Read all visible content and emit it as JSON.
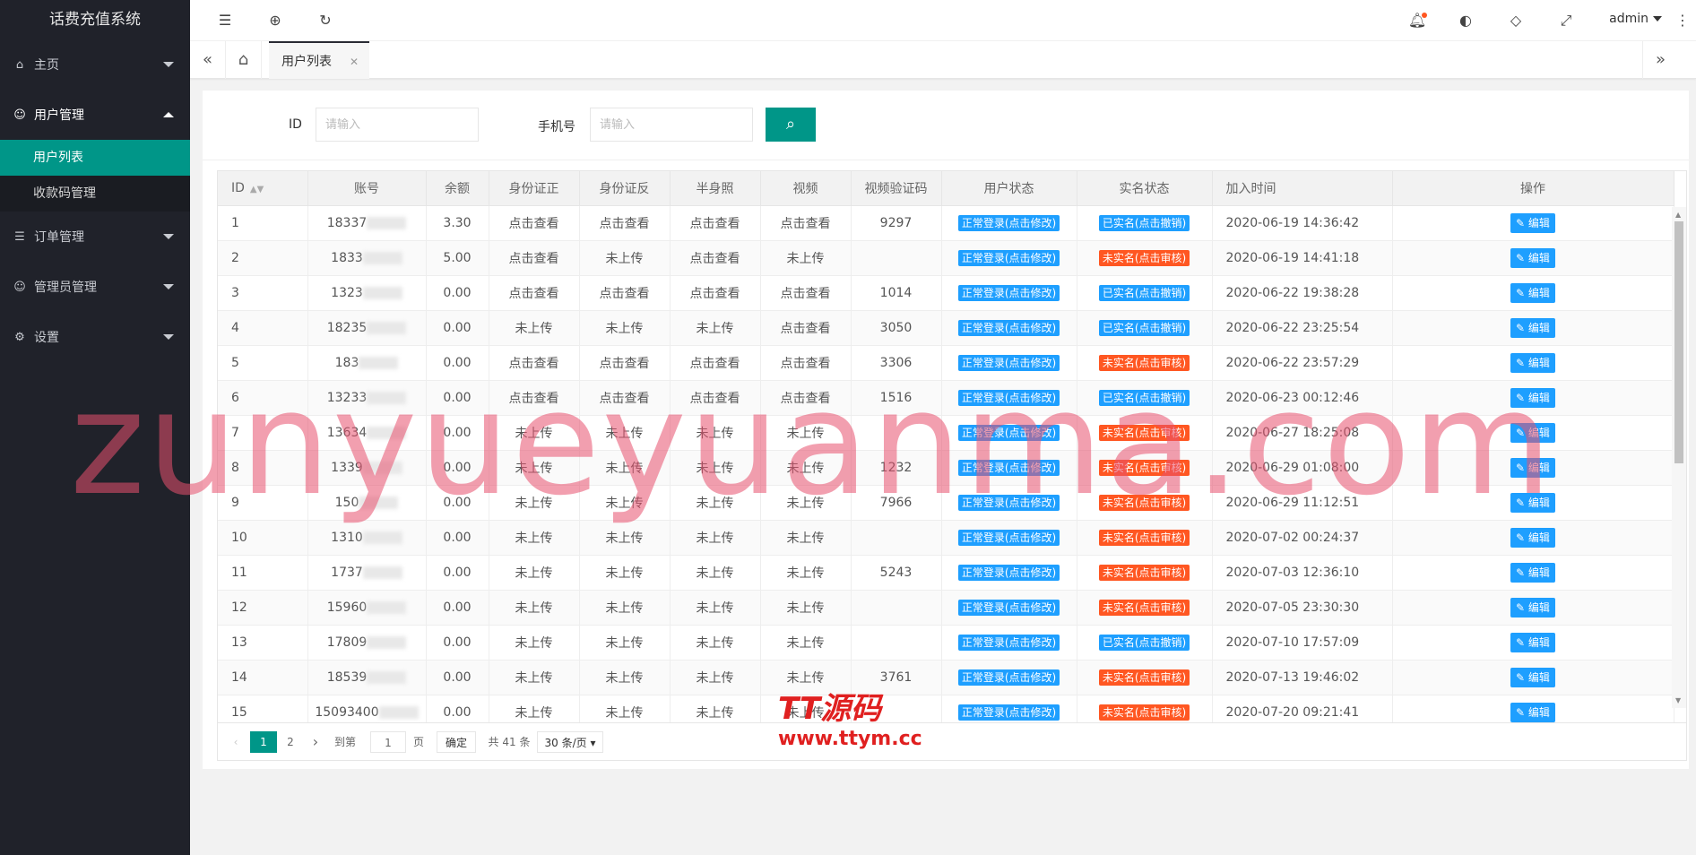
{
  "app": {
    "title": "话费充值系统"
  },
  "sidebar": {
    "items": [
      {
        "label": "主页",
        "icon": "home-icon",
        "open": false
      },
      {
        "label": "用户管理",
        "icon": "user-icon",
        "open": true,
        "children": [
          "用户列表",
          "收款码管理"
        ]
      },
      {
        "label": "订单管理",
        "icon": "list-icon",
        "open": false
      },
      {
        "label": "管理员管理",
        "icon": "user-icon",
        "open": false
      },
      {
        "label": "设置",
        "icon": "gear-icon",
        "open": false
      }
    ]
  },
  "header": {
    "user": "admin"
  },
  "tabs": {
    "active": "用户列表"
  },
  "search": {
    "id_label": "ID",
    "id_placeholder": "请输入",
    "phone_label": "手机号",
    "phone_placeholder": "请输入"
  },
  "table": {
    "columns": [
      "ID",
      "账号",
      "余额",
      "身份证正",
      "身份证反",
      "半身照",
      "视频",
      "视频验证码",
      "用户状态",
      "实名状态",
      "加入时间",
      "操作"
    ],
    "edit_label": "编辑",
    "rows": [
      [
        "1",
        "18337",
        "3.30",
        "点击查看",
        "点击查看",
        "点击查看",
        "点击查看",
        "9297",
        "正常登录(点击修改)",
        "已实名(点击撤销)",
        "2020-06-19 14:36:42"
      ],
      [
        "2",
        "1833",
        "5.00",
        "点击查看",
        "未上传",
        "点击查看",
        "未上传",
        "",
        "正常登录(点击修改)",
        "未实名(点击审核)",
        "2020-06-19 14:41:18"
      ],
      [
        "3",
        "1323",
        "0.00",
        "点击查看",
        "点击查看",
        "点击查看",
        "点击查看",
        "1014",
        "正常登录(点击修改)",
        "已实名(点击撤销)",
        "2020-06-22 19:38:28"
      ],
      [
        "4",
        "18235",
        "0.00",
        "未上传",
        "未上传",
        "未上传",
        "点击查看",
        "3050",
        "正常登录(点击修改)",
        "已实名(点击撤销)",
        "2020-06-22 23:25:54"
      ],
      [
        "5",
        "183",
        "0.00",
        "点击查看",
        "点击查看",
        "点击查看",
        "点击查看",
        "3306",
        "正常登录(点击修改)",
        "未实名(点击审核)",
        "2020-06-22 23:57:29"
      ],
      [
        "6",
        "13233",
        "0.00",
        "点击查看",
        "点击查看",
        "点击查看",
        "点击查看",
        "1516",
        "正常登录(点击修改)",
        "已实名(点击撤销)",
        "2020-06-23 00:12:46"
      ],
      [
        "7",
        "13634",
        "0.00",
        "未上传",
        "未上传",
        "未上传",
        "未上传",
        "",
        "正常登录(点击修改)",
        "未实名(点击审核)",
        "2020-06-27 18:25:08"
      ],
      [
        "8",
        "1339",
        "0.00",
        "未上传",
        "未上传",
        "未上传",
        "未上传",
        "1232",
        "正常登录(点击修改)",
        "未实名(点击审核)",
        "2020-06-29 01:08:00"
      ],
      [
        "9",
        "150",
        "0.00",
        "未上传",
        "未上传",
        "未上传",
        "未上传",
        "7966",
        "正常登录(点击修改)",
        "未实名(点击审核)",
        "2020-06-29 11:12:51"
      ],
      [
        "10",
        "1310",
        "0.00",
        "未上传",
        "未上传",
        "未上传",
        "未上传",
        "",
        "正常登录(点击修改)",
        "未实名(点击审核)",
        "2020-07-02 00:24:37"
      ],
      [
        "11",
        "1737",
        "0.00",
        "未上传",
        "未上传",
        "未上传",
        "未上传",
        "5243",
        "正常登录(点击修改)",
        "未实名(点击审核)",
        "2020-07-03 12:36:10"
      ],
      [
        "12",
        "15960",
        "0.00",
        "未上传",
        "未上传",
        "未上传",
        "未上传",
        "",
        "正常登录(点击修改)",
        "未实名(点击审核)",
        "2020-07-05 23:30:30"
      ],
      [
        "13",
        "17809",
        "0.00",
        "未上传",
        "未上传",
        "未上传",
        "未上传",
        "",
        "正常登录(点击修改)",
        "已实名(点击撤销)",
        "2020-07-10 17:57:09"
      ],
      [
        "14",
        "18539",
        "0.00",
        "未上传",
        "未上传",
        "未上传",
        "未上传",
        "3761",
        "正常登录(点击修改)",
        "未实名(点击审核)",
        "2020-07-13 19:46:02"
      ],
      [
        "15",
        "15093400",
        "0.00",
        "未上传",
        "未上传",
        "未上传",
        "未上传",
        "",
        "正常登录(点击修改)",
        "未实名(点击审核)",
        "2020-07-20 09:21:41"
      ]
    ]
  },
  "pagination": {
    "current": "1",
    "page2": "2",
    "goto_label": "到第",
    "goto_value": "1",
    "page_unit": "页",
    "confirm": "确定",
    "total": "共 41 条",
    "per_page": "30 条/页"
  },
  "watermark": "zunyueyuanma.com",
  "overlay_logo": {
    "line1": "TT源码",
    "line2": "www.ttym.cc"
  },
  "colors": {
    "accent": "#009688",
    "sidebar": "#20222a",
    "blue": "#1e9fff",
    "orange": "#ff5722"
  }
}
